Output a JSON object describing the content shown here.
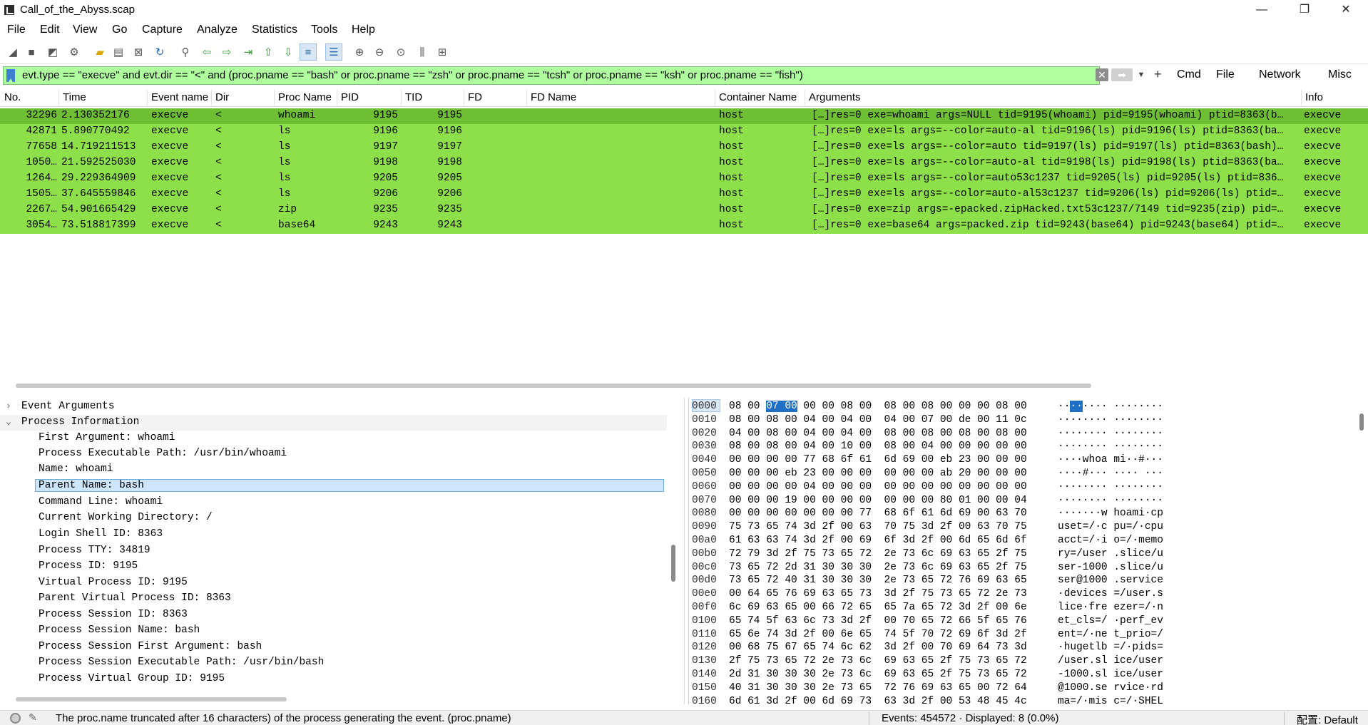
{
  "window": {
    "title": "Call_of_the_Abyss.scap",
    "minimize": "—",
    "maximize": "❐",
    "close": "✕"
  },
  "menu": [
    "File",
    "Edit",
    "View",
    "Go",
    "Capture",
    "Analyze",
    "Statistics",
    "Tools",
    "Help"
  ],
  "filter": {
    "value": "evt.type == \"execve\" and evt.dir == \"<\" and (proc.pname == \"bash\" or proc.pname == \"zsh\" or proc.pname == \"tcsh\" or proc.pname == \"ksh\" or proc.pname == \"fish\")",
    "clear_glyph": "✕",
    "apply_glyph": "➡",
    "add_glyph": "+",
    "buttons": [
      "Cmd",
      "File",
      "Network",
      "Misc"
    ]
  },
  "columns": [
    "No.",
    "Time",
    "Event name",
    "Dir",
    "Proc Name",
    "PID",
    "TID",
    "FD",
    "FD Name",
    "Container Name",
    "Arguments",
    "Info"
  ],
  "rows": [
    {
      "no": "32296",
      "time": "2.130352176",
      "event": "execve",
      "dir": "<",
      "proc": "whoami",
      "pid": "9195",
      "tid": "9195",
      "fd": "",
      "fdname": "",
      "container": "host",
      "args": "[…]res=0 exe=whoami args=NULL tid=9195(whoami) pid=9195(whoami) ptid=8363(b…",
      "info": "execve"
    },
    {
      "no": "42871",
      "time": "5.890770492",
      "event": "execve",
      "dir": "<",
      "proc": "ls",
      "pid": "9196",
      "tid": "9196",
      "fd": "",
      "fdname": "",
      "container": "host",
      "args": "[…]res=0 exe=ls args=--color=auto-al tid=9196(ls) pid=9196(ls) ptid=8363(ba…",
      "info": "execve"
    },
    {
      "no": "77658",
      "time": "14.719211513",
      "event": "execve",
      "dir": "<",
      "proc": "ls",
      "pid": "9197",
      "tid": "9197",
      "fd": "",
      "fdname": "",
      "container": "host",
      "args": "[…]res=0 exe=ls args=--color=auto tid=9197(ls) pid=9197(ls) ptid=8363(bash)…",
      "info": "execve"
    },
    {
      "no": "1050…",
      "time": "21.592525030",
      "event": "execve",
      "dir": "<",
      "proc": "ls",
      "pid": "9198",
      "tid": "9198",
      "fd": "",
      "fdname": "",
      "container": "host",
      "args": "[…]res=0 exe=ls args=--color=auto-al tid=9198(ls) pid=9198(ls) ptid=8363(ba…",
      "info": "execve"
    },
    {
      "no": "1264…",
      "time": "29.229364909",
      "event": "execve",
      "dir": "<",
      "proc": "ls",
      "pid": "9205",
      "tid": "9205",
      "fd": "",
      "fdname": "",
      "container": "host",
      "args": "[…]res=0 exe=ls args=--color=auto53c1237 tid=9205(ls) pid=9205(ls) ptid=836…",
      "info": "execve"
    },
    {
      "no": "1505…",
      "time": "37.645559846",
      "event": "execve",
      "dir": "<",
      "proc": "ls",
      "pid": "9206",
      "tid": "9206",
      "fd": "",
      "fdname": "",
      "container": "host",
      "args": "[…]res=0 exe=ls args=--color=auto-al53c1237 tid=9206(ls) pid=9206(ls) ptid=…",
      "info": "execve"
    },
    {
      "no": "2267…",
      "time": "54.901665429",
      "event": "execve",
      "dir": "<",
      "proc": "zip",
      "pid": "9235",
      "tid": "9235",
      "fd": "",
      "fdname": "",
      "container": "host",
      "args": "[…]res=0 exe=zip args=-epacked.zipHacked.txt53c1237/7149 tid=9235(zip) pid=…",
      "info": "execve"
    },
    {
      "no": "3054…",
      "time": "73.518817399",
      "event": "execve",
      "dir": "<",
      "proc": "base64",
      "pid": "9243",
      "tid": "9243",
      "fd": "",
      "fdname": "",
      "container": "host",
      "args": "[…]res=0 exe=base64 args=packed.zip tid=9243(base64) pid=9243(base64) ptid=…",
      "info": "execve"
    }
  ],
  "tree": {
    "collapsed_arrow": "›",
    "expanded_arrow": "⌄",
    "sections": [
      "Event Arguments",
      "Process Information"
    ],
    "items": [
      "First Argument: whoami",
      "Process Executable Path: /usr/bin/whoami",
      "Name: whoami",
      "Parent Name: bash",
      "Command Line: whoami",
      "Current Working Directory: /",
      "Login Shell ID: 8363",
      "Process TTY: 34819",
      "Process ID: 9195",
      "Virtual Process ID: 9195",
      "Parent Virtual Process ID: 8363",
      "Process Session ID: 8363",
      "Process Session Name: bash",
      "Process Session First Argument: bash",
      "Process Session Executable Path: /usr/bin/bash",
      "Process Virtual Group ID: 9195"
    ]
  },
  "hex": [
    {
      "off": "0000",
      "bytes": "08 00 07 00 00 00 08 00  08 00 08 00 00 00 08 00",
      "ascii": "········ ········"
    },
    {
      "off": "0010",
      "bytes": "08 00 08 00 04 00 04 00  04 00 07 00 de 00 11 0c",
      "ascii": "········ ········"
    },
    {
      "off": "0020",
      "bytes": "04 00 08 00 04 00 04 00  08 00 08 00 08 00 08 00",
      "ascii": "········ ········"
    },
    {
      "off": "0030",
      "bytes": "08 00 08 00 04 00 10 00  08 00 04 00 00 00 00 00",
      "ascii": "········ ········"
    },
    {
      "off": "0040",
      "bytes": "00 00 00 00 77 68 6f 61  6d 69 00 eb 23 00 00 00",
      "ascii": "····whoa mi··#···"
    },
    {
      "off": "0050",
      "bytes": "00 00 00 eb 23 00 00 00  00 00 00 ab 20 00 00 00",
      "ascii": "····#··· ···· ···"
    },
    {
      "off": "0060",
      "bytes": "00 00 00 00 04 00 00 00  00 00 00 00 00 00 00 00",
      "ascii": "········ ········"
    },
    {
      "off": "0070",
      "bytes": "00 00 00 19 00 00 00 00  00 00 00 80 01 00 00 04",
      "ascii": "········ ········"
    },
    {
      "off": "0080",
      "bytes": "00 00 00 00 00 00 00 77  68 6f 61 6d 69 00 63 70",
      "ascii": "·······w hoami·cp"
    },
    {
      "off": "0090",
      "bytes": "75 73 65 74 3d 2f 00 63  70 75 3d 2f 00 63 70 75",
      "ascii": "uset=/·c pu=/·cpu"
    },
    {
      "off": "00a0",
      "bytes": "61 63 63 74 3d 2f 00 69  6f 3d 2f 00 6d 65 6d 6f",
      "ascii": "acct=/·i o=/·memo"
    },
    {
      "off": "00b0",
      "bytes": "72 79 3d 2f 75 73 65 72  2e 73 6c 69 63 65 2f 75",
      "ascii": "ry=/user .slice/u"
    },
    {
      "off": "00c0",
      "bytes": "73 65 72 2d 31 30 30 30  2e 73 6c 69 63 65 2f 75",
      "ascii": "ser-1000 .slice/u"
    },
    {
      "off": "00d0",
      "bytes": "73 65 72 40 31 30 30 30  2e 73 65 72 76 69 63 65",
      "ascii": "ser@1000 .service"
    },
    {
      "off": "00e0",
      "bytes": "00 64 65 76 69 63 65 73  3d 2f 75 73 65 72 2e 73",
      "ascii": "·devices =/user.s"
    },
    {
      "off": "00f0",
      "bytes": "6c 69 63 65 00 66 72 65  65 7a 65 72 3d 2f 00 6e",
      "ascii": "lice·fre ezer=/·n"
    },
    {
      "off": "0100",
      "bytes": "65 74 5f 63 6c 73 3d 2f  00 70 65 72 66 5f 65 76",
      "ascii": "et_cls=/ ·perf_ev"
    },
    {
      "off": "0110",
      "bytes": "65 6e 74 3d 2f 00 6e 65  74 5f 70 72 69 6f 3d 2f",
      "ascii": "ent=/·ne t_prio=/"
    },
    {
      "off": "0120",
      "bytes": "00 68 75 67 65 74 6c 62  3d 2f 00 70 69 64 73 3d",
      "ascii": "·hugetlb =/·pids="
    },
    {
      "off": "0130",
      "bytes": "2f 75 73 65 72 2e 73 6c  69 63 65 2f 75 73 65 72",
      "ascii": "/user.sl ice/user"
    },
    {
      "off": "0140",
      "bytes": "2d 31 30 30 30 2e 73 6c  69 63 65 2f 75 73 65 72",
      "ascii": "-1000.sl ice/user"
    },
    {
      "off": "0150",
      "bytes": "40 31 30 30 30 2e 73 65  72 76 69 63 65 00 72 64",
      "ascii": "@1000.se rvice·rd"
    },
    {
      "off": "0160",
      "bytes": "6d 61 3d 2f 00 6d 69 73  63 3d 2f 00 53 48 45 4c",
      "ascii": "ma=/·mis c=/·SHEL"
    }
  ],
  "status": {
    "message": "The proc.name truncated after 16 characters) of the process generating the event. (proc.pname)",
    "events": "Events: 454572 · Displayed: 8 (0.0%)",
    "profile": "配置: Default"
  },
  "icons": [
    "shark-fin-start-icon",
    "stop-icon",
    "restart-icon",
    "options-gear-icon",
    "open-folder-icon",
    "save-icon",
    "close-file-icon",
    "reload-icon",
    "find-icon",
    "back-arrow-icon",
    "forward-arrow-icon",
    "go-to-icon",
    "first-icon",
    "last-icon",
    "autoscroll-icon",
    "colorize-icon",
    "zoom-in-icon",
    "zoom-out-icon",
    "zoom-reset-icon",
    "resize-columns-icon",
    "layout-icon"
  ],
  "colors": {
    "row_green": "#8ee04a",
    "filter_green": "#afff9f",
    "selection_blue": "#1f6fc5"
  }
}
